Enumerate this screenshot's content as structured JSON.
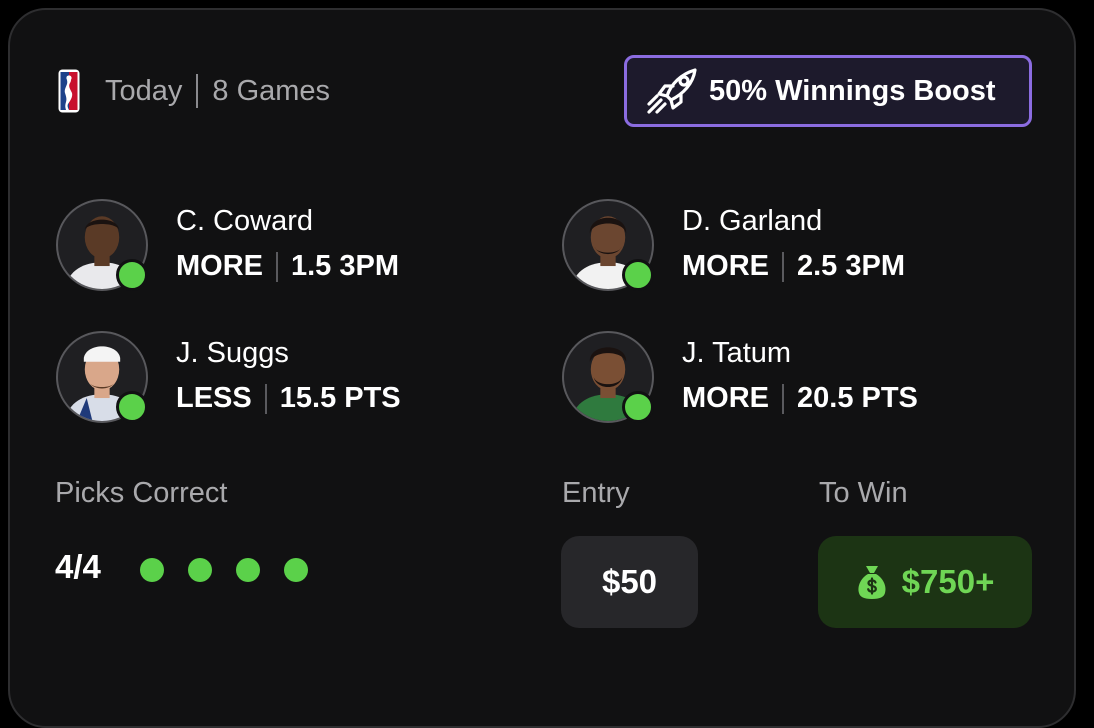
{
  "header": {
    "league_icon": "nba-logo-icon",
    "day": "Today",
    "games": "8 Games",
    "boost_icon": "rocket-icon",
    "boost_label": "50% Winnings Boost"
  },
  "picks": [
    {
      "name": "C. Coward",
      "direction": "MORE",
      "line": "1.5 3PM",
      "status": "hit",
      "jersey_color": "#e9e9ec"
    },
    {
      "name": "D. Garland",
      "direction": "MORE",
      "line": "2.5 3PM",
      "status": "hit",
      "jersey_color": "#f2f2f2"
    },
    {
      "name": "J. Suggs",
      "direction": "LESS",
      "line": "15.5 PTS",
      "status": "hit",
      "jersey_color": "#d8dde8"
    },
    {
      "name": "J. Tatum",
      "direction": "MORE",
      "line": "20.5 PTS",
      "status": "hit",
      "jersey_color": "#2f7a3e"
    }
  ],
  "summary": {
    "picks_label": "Picks Correct",
    "picks_value": "4/4",
    "correct_count": 4,
    "entry_label": "Entry",
    "entry_value": "$50",
    "win_label": "To Win",
    "win_icon": "money-bag-icon",
    "win_value": "$750+"
  },
  "colors": {
    "accent_green": "#5bd14a",
    "boost_border": "#8b6ce0",
    "win_bg": "#1c3414"
  }
}
